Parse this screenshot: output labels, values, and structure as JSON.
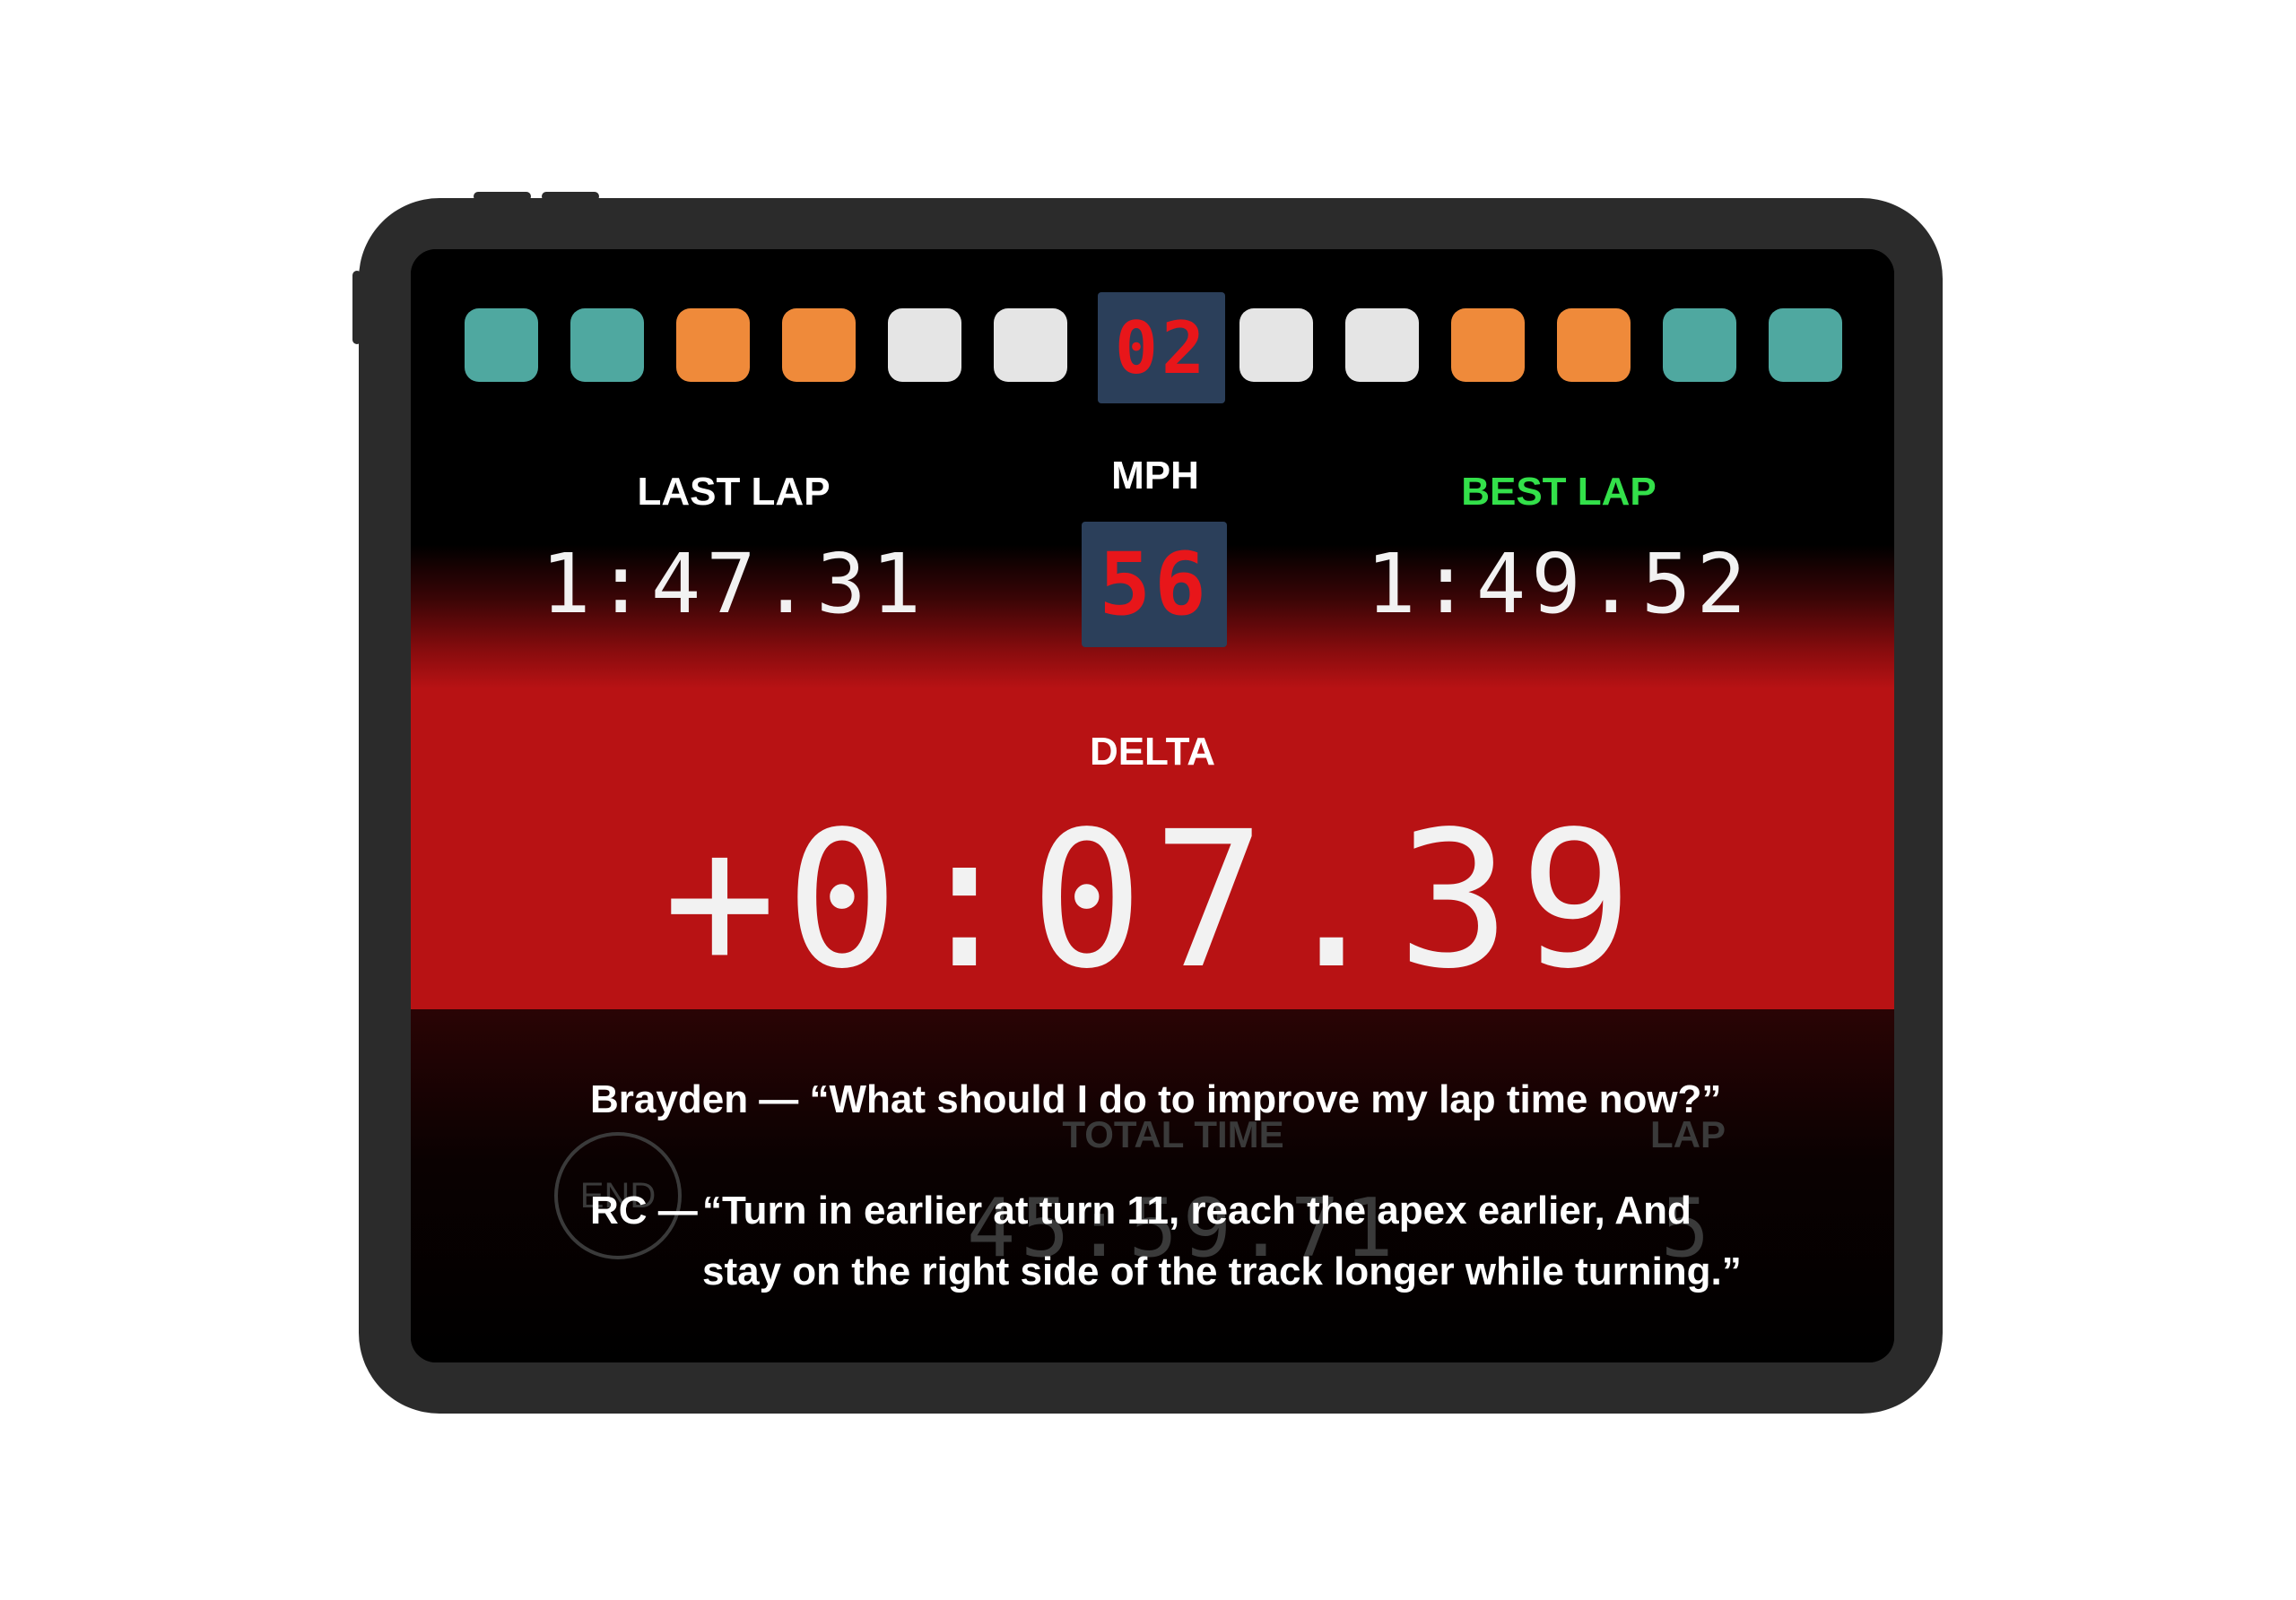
{
  "position_display": "02",
  "lights": [
    {
      "name": "light-1",
      "color": "#4fa8a0"
    },
    {
      "name": "light-2",
      "color": "#4fa8a0"
    },
    {
      "name": "light-3",
      "color": "#ef8a3a"
    },
    {
      "name": "light-4",
      "color": "#ef8a3a"
    },
    {
      "name": "light-5",
      "color": "#e5e5e5"
    },
    {
      "name": "light-6",
      "color": "#e5e5e5"
    },
    {
      "name": "light-7",
      "color": "#e5e5e5"
    },
    {
      "name": "light-8",
      "color": "#e5e5e5"
    },
    {
      "name": "light-9",
      "color": "#ef8a3a"
    },
    {
      "name": "light-10",
      "color": "#ef8a3a"
    },
    {
      "name": "light-11",
      "color": "#4fa8a0"
    },
    {
      "name": "light-12",
      "color": "#4fa8a0"
    }
  ],
  "last_lap": {
    "label": "LAST LAP",
    "value": "1:47.31"
  },
  "mph": {
    "label": "MPH",
    "value": "56"
  },
  "best_lap": {
    "label": "BEST LAP",
    "value": "1:49.52",
    "color": "#33e04a"
  },
  "delta": {
    "label": "DELTA",
    "value": "+0:07.39"
  },
  "background_panel": {
    "end_button": "END",
    "total_time_label": "TOTAL TIME",
    "total_time_value": "45:59.71",
    "lap_label": "LAP",
    "lap_value": "5"
  },
  "conversation": {
    "line1": "Brayden — “What should I do to improve my lap time now?”",
    "line2_speaker": "RC —",
    "line2_text": "“Turn in earlier at turn 11, reach the apex earlier, And stay on the right side of the track longer while turning.”"
  },
  "colors": {
    "accent_red": "#b81214",
    "segment_red": "#e8161a",
    "segment_bg": "#2b3f5a",
    "frame": "#2b2b2b"
  }
}
